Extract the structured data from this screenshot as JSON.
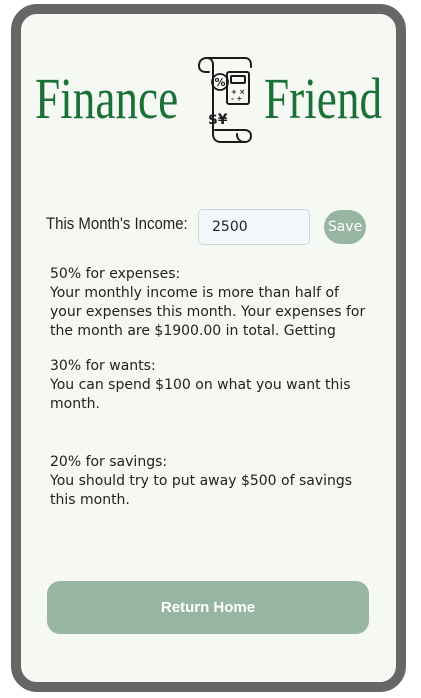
{
  "header": {
    "title_left": "Finance",
    "title_right": "Friend",
    "logo_icon": "calculator-receipt-icon",
    "logo_symbols": {
      "percent": "%",
      "currency": "$¥",
      "calc_top": "+ ×",
      "calc_bottom": "- ÷"
    }
  },
  "income": {
    "label": "This Month's Income:",
    "value": "2500",
    "save_label": "Save"
  },
  "breakdown": {
    "expenses": {
      "heading": "50% for expenses:",
      "body": "Your monthly income is more than half of your expenses this month. Your expenses for the month are $1900.00 in total. Getting"
    },
    "wants": {
      "heading": "30% for wants:",
      "body": "You can spend $100 on what you want this month."
    },
    "savings": {
      "heading": "20% for savings:",
      "body": "You should try to put away $500 of savings this month."
    }
  },
  "footer": {
    "return_label": "Return Home"
  },
  "colors": {
    "brand_green": "#1a7036",
    "button_sage": "#98b5a2",
    "frame_gray": "#666666",
    "background": "#f6f9f3"
  }
}
